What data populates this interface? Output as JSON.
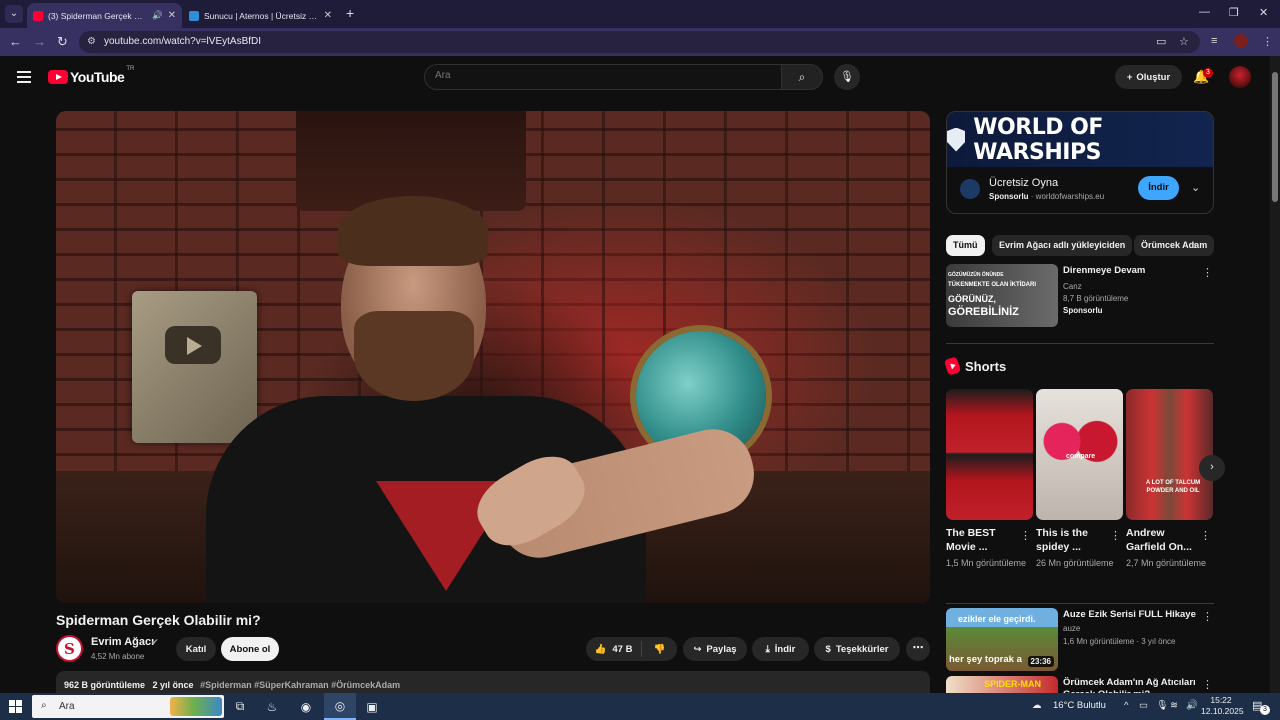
{
  "browser": {
    "tabs": [
      {
        "title": "(3) Spiderman Gerçek Olabilir mi?",
        "active": true,
        "favicon_color": "#ff0033"
      },
      {
        "title": "Sunucu | Aternos | Ücretsiz Minecraft",
        "active": false,
        "favicon_color": "#2f8fd6"
      }
    ],
    "url": "youtube.com/watch?v=lVEytAsBfDI"
  },
  "header": {
    "logo_text": "YouTube",
    "country_code": "TR",
    "search_placeholder": "Ara",
    "create_label": "Oluştur",
    "notification_count": "3"
  },
  "video": {
    "title": "Spiderman Gerçek Olabilir mi?",
    "channel": "Evrim Ağacı",
    "subscribers": "4,52 Mn abone",
    "join_label": "Katıl",
    "subscribe_label": "Abone ol",
    "likes": "47 B",
    "share_label": "Paylaş",
    "download_label": "İndir",
    "thanks_label": "Teşekkürler",
    "views": "962 B görüntüleme",
    "age": "2 yıl önce",
    "hashtags": "#Spiderman #SüperKahraman #ÖrümcekAdam"
  },
  "ad": {
    "banner_text": "WORLD OF WARSHIPS",
    "title": "Ücretsiz Oyna",
    "sponsored": "Sponsorlu",
    "domain": "worldofwarships.eu",
    "cta": "İndir"
  },
  "chips": [
    "Tümü",
    "Evrim Ağacı adlı yükleyiciden",
    "Örümcek Adam"
  ],
  "recommendations": [
    {
      "title": "Direnmeye Devam",
      "channel": "Canz",
      "meta": "8,7 B görüntüleme",
      "badge": "Sponsorlu",
      "thumb_text_1": "GÖZÜMÜZÜN ÖNÜNDE",
      "thumb_text_2": "TÜKENMEKTE OLAN İKTİDARI",
      "thumb_text_3": "GÖRÜNÜZ,",
      "thumb_text_4": "GÖREBİLİNİZ"
    },
    {
      "title": "Auze Ezik Serisi FULL Hikaye",
      "channel": "auze",
      "meta": "1,6 Mn görüntüleme · 3 yıl önce",
      "duration": "23:36",
      "thumb_text_1": "ezikler ele geçirdi.",
      "thumb_text_2": "her şey toprak a"
    },
    {
      "title": "Örümcek Adam'ın Ağ Atıcıları Gerçek Olabilir mi?",
      "thumb_text_1": "SPIDER-MAN"
    }
  ],
  "shorts": {
    "heading": "Shorts",
    "items": [
      {
        "title": "The BEST Movie ...",
        "views": "1,5 Mn görüntüleme"
      },
      {
        "title": "This is the spidey ...",
        "views": "26 Mn görüntüleme",
        "overlay": "compare"
      },
      {
        "title": "Andrew Garfield On...",
        "views": "2,7 Mn görüntüleme",
        "overlay": "A LOT OF TALCUM POWDER AND OIL"
      }
    ]
  },
  "taskbar": {
    "search_placeholder": "Ara",
    "weather": "16°C  Bulutlu",
    "time": "15:22",
    "date": "12.10.2025",
    "notification_count": "3"
  },
  "colors": {
    "background": "#0f0f0f",
    "accent_red": "#ff0033",
    "cta_blue": "#3ea6ff",
    "browser_frame": "#1f1c3a"
  }
}
